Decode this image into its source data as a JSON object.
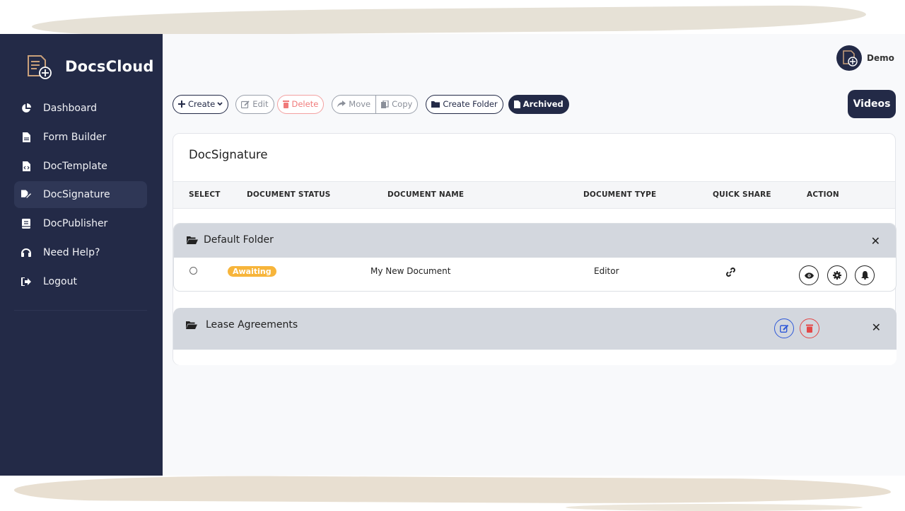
{
  "app": {
    "name": "DocsCloud"
  },
  "sidebar": {
    "items": [
      {
        "label": "Dashboard",
        "icon": "pie-chart-icon"
      },
      {
        "label": "Form Builder",
        "icon": "file-icon"
      },
      {
        "label": "DocTemplate",
        "icon": "file-code-icon"
      },
      {
        "label": "DocSignature",
        "icon": "signature-icon",
        "active": true
      },
      {
        "label": "DocPublisher",
        "icon": "book-icon"
      },
      {
        "label": "Need Help?",
        "icon": "headset-icon"
      },
      {
        "label": "Logout",
        "icon": "logout-icon"
      }
    ]
  },
  "header": {
    "user_name": "Demo",
    "videos_label": "Videos"
  },
  "toolbar": {
    "create": "Create",
    "edit": "Edit",
    "delete": "Delete",
    "move": "Move",
    "copy": "Copy",
    "create_folder": "Create Folder",
    "archived": "Archived"
  },
  "main": {
    "title": "DocSignature",
    "columns": [
      "SELECT",
      "DOCUMENT STATUS",
      "DOCUMENT NAME",
      "DOCUMENT TYPE",
      "QUICK SHARE",
      "ACTION"
    ],
    "folders": [
      {
        "name": "Default Folder",
        "rows": [
          {
            "status": "Awaiting",
            "name": "My New Document",
            "type": "Editor"
          }
        ]
      },
      {
        "name": "Lease Agreements",
        "rows": []
      }
    ]
  },
  "colors": {
    "sidebar_bg": "#232a47",
    "badge_awaiting": "#f7b53b",
    "danger": "#e34848",
    "edit_blue": "#2f59d8"
  }
}
